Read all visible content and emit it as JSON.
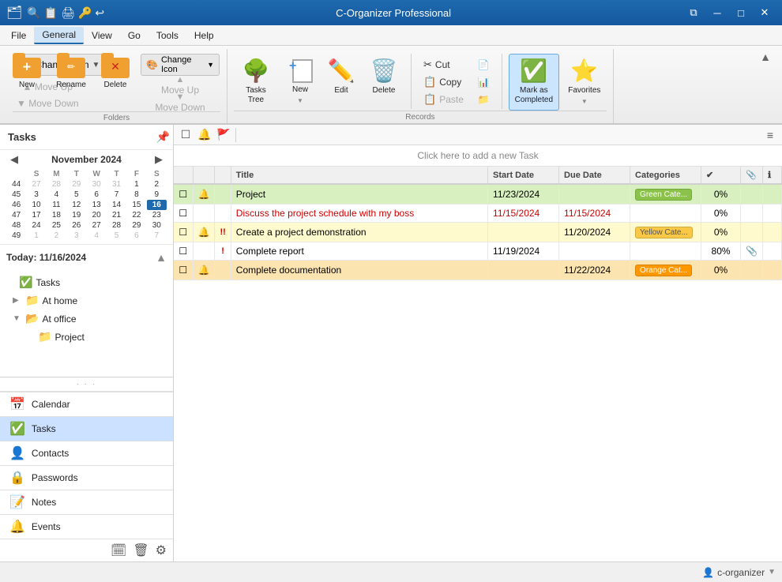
{
  "app": {
    "title": "C-Organizer Professional",
    "titlebar_icons": [
      "🔍",
      "📋",
      "🖨",
      "🔑",
      "↩"
    ]
  },
  "menubar": {
    "items": [
      "File",
      "General",
      "View",
      "Go",
      "Tools",
      "Help"
    ],
    "active": "General"
  },
  "ribbon": {
    "folders_group": {
      "label": "Folders",
      "change_icon_label": "Change Icon",
      "move_up_label": "Move Up",
      "move_down_label": "Move Down",
      "new_btn_label": "New",
      "rename_btn_label": "Rename",
      "delete_btn_label": "Delete"
    },
    "records_group": {
      "label": "Records",
      "tasks_tree_label": "Tasks\nTree",
      "new_label": "New",
      "edit_label": "Edit",
      "delete_label": "Delete",
      "cut_label": "Cut",
      "copy_label": "Copy",
      "paste_label": "Paste",
      "mark_completed_label": "Mark as\nCompleted",
      "favorites_label": "Favorites"
    }
  },
  "sidebar": {
    "title": "Tasks",
    "today_label": "Today: 11/16/2024",
    "calendar": {
      "month": "November 2024",
      "weekdays": [
        "S",
        "M",
        "T",
        "W",
        "T",
        "F",
        "S"
      ],
      "weeks": [
        {
          "num": "44",
          "days": [
            {
              "d": "27",
              "other": true
            },
            {
              "d": "28",
              "other": true
            },
            {
              "d": "29",
              "other": true
            },
            {
              "d": "30",
              "other": true
            },
            {
              "d": "31",
              "other": true
            },
            {
              "d": "1",
              "other": false
            },
            {
              "d": "2",
              "other": false
            }
          ]
        },
        {
          "num": "45",
          "days": [
            {
              "d": "3",
              "other": false
            },
            {
              "d": "4",
              "other": false
            },
            {
              "d": "5",
              "other": false
            },
            {
              "d": "6",
              "other": false
            },
            {
              "d": "7",
              "other": false
            },
            {
              "d": "8",
              "other": false
            },
            {
              "d": "9",
              "other": false
            }
          ]
        },
        {
          "num": "46",
          "days": [
            {
              "d": "10",
              "other": false
            },
            {
              "d": "11",
              "other": false
            },
            {
              "d": "12",
              "other": false
            },
            {
              "d": "13",
              "other": false
            },
            {
              "d": "14",
              "other": false
            },
            {
              "d": "15",
              "other": false
            },
            {
              "d": "16",
              "today": true
            }
          ]
        },
        {
          "num": "47",
          "days": [
            {
              "d": "17",
              "other": false
            },
            {
              "d": "18",
              "other": false
            },
            {
              "d": "19",
              "other": false
            },
            {
              "d": "20",
              "other": false
            },
            {
              "d": "21",
              "other": false
            },
            {
              "d": "22",
              "other": false
            },
            {
              "d": "23",
              "other": false
            }
          ]
        },
        {
          "num": "48",
          "days": [
            {
              "d": "24",
              "other": false
            },
            {
              "d": "25",
              "other": false
            },
            {
              "d": "26",
              "other": false
            },
            {
              "d": "27",
              "other": false
            },
            {
              "d": "28",
              "other": false
            },
            {
              "d": "29",
              "other": false
            },
            {
              "d": "30",
              "other": false
            }
          ]
        },
        {
          "num": "49",
          "days": [
            {
              "d": "1",
              "other": true
            },
            {
              "d": "2",
              "other": true
            },
            {
              "d": "3",
              "other": true
            },
            {
              "d": "4",
              "other": true
            },
            {
              "d": "5",
              "other": true
            },
            {
              "d": "6",
              "other": true
            },
            {
              "d": "7",
              "other": true
            }
          ]
        }
      ]
    },
    "tree": [
      {
        "label": "Tasks",
        "icon": "📋",
        "level": 0,
        "expand": ""
      },
      {
        "label": "At home",
        "icon": "📁",
        "level": 1,
        "expand": "▶"
      },
      {
        "label": "At office",
        "icon": "📂",
        "level": 1,
        "expand": "▼",
        "expanded": true
      },
      {
        "label": "Project",
        "icon": "📁",
        "level": 2,
        "expand": ""
      }
    ],
    "nav_items": [
      {
        "label": "Calendar",
        "icon": "📅"
      },
      {
        "label": "Tasks",
        "icon": "✅",
        "active": true
      },
      {
        "label": "Contacts",
        "icon": "👤"
      },
      {
        "label": "Passwords",
        "icon": "🔒"
      },
      {
        "label": "Notes",
        "icon": "📝"
      },
      {
        "label": "Events",
        "icon": "🔔"
      }
    ],
    "bottom_icons": [
      "🗓",
      "🗑",
      "⚙"
    ]
  },
  "tasks": {
    "add_bar_label": "Click here to add a new Task",
    "columns": {
      "check": "",
      "sound": "",
      "priority": "",
      "title": "Title",
      "start_date": "Start Date",
      "due_date": "Due Date",
      "categories": "Categories",
      "complete": "✔",
      "attach": "📎",
      "info": "ℹ"
    },
    "rows": [
      {
        "row_class": "row-green",
        "check": "☐",
        "sound": "🔔",
        "priority": "",
        "title": "Project",
        "start_date": "11/23/2024",
        "due_date": "",
        "category": "Green Cate...",
        "cat_class": "cat-green",
        "complete": "0%",
        "attach": "",
        "info": ""
      },
      {
        "row_class": "row-white",
        "check": "☐",
        "sound": "",
        "priority": "",
        "title": "Discuss the project schedule with my boss",
        "title_color": "#cc0000",
        "start_date": "11/15/2024",
        "start_color": "#cc0000",
        "due_date": "11/15/2024",
        "due_color": "#cc0000",
        "category": "",
        "cat_class": "",
        "complete": "0%",
        "attach": "",
        "info": ""
      },
      {
        "row_class": "row-yellow",
        "check": "☐",
        "sound": "🔔",
        "priority": "!!",
        "title": "Create a project demonstration",
        "start_date": "",
        "due_date": "11/20/2024",
        "category": "Yellow Cate...",
        "cat_class": "cat-yellow",
        "complete": "0%",
        "attach": "",
        "info": ""
      },
      {
        "row_class": "row-plain",
        "check": "☐",
        "sound": "",
        "priority": "!",
        "title": "Complete report",
        "start_date": "11/19/2024",
        "due_date": "",
        "category": "",
        "cat_class": "",
        "complete": "80%",
        "attach": "📎",
        "info": ""
      },
      {
        "row_class": "row-orange",
        "check": "☐",
        "sound": "🔔",
        "priority": "",
        "title": "Complete documentation",
        "start_date": "",
        "due_date": "11/22/2024",
        "category": "Orange Cat...",
        "cat_class": "cat-orange",
        "complete": "0%",
        "attach": "",
        "info": ""
      }
    ]
  },
  "status": {
    "user": "c-organizer",
    "dropdown_icon": "▼"
  }
}
